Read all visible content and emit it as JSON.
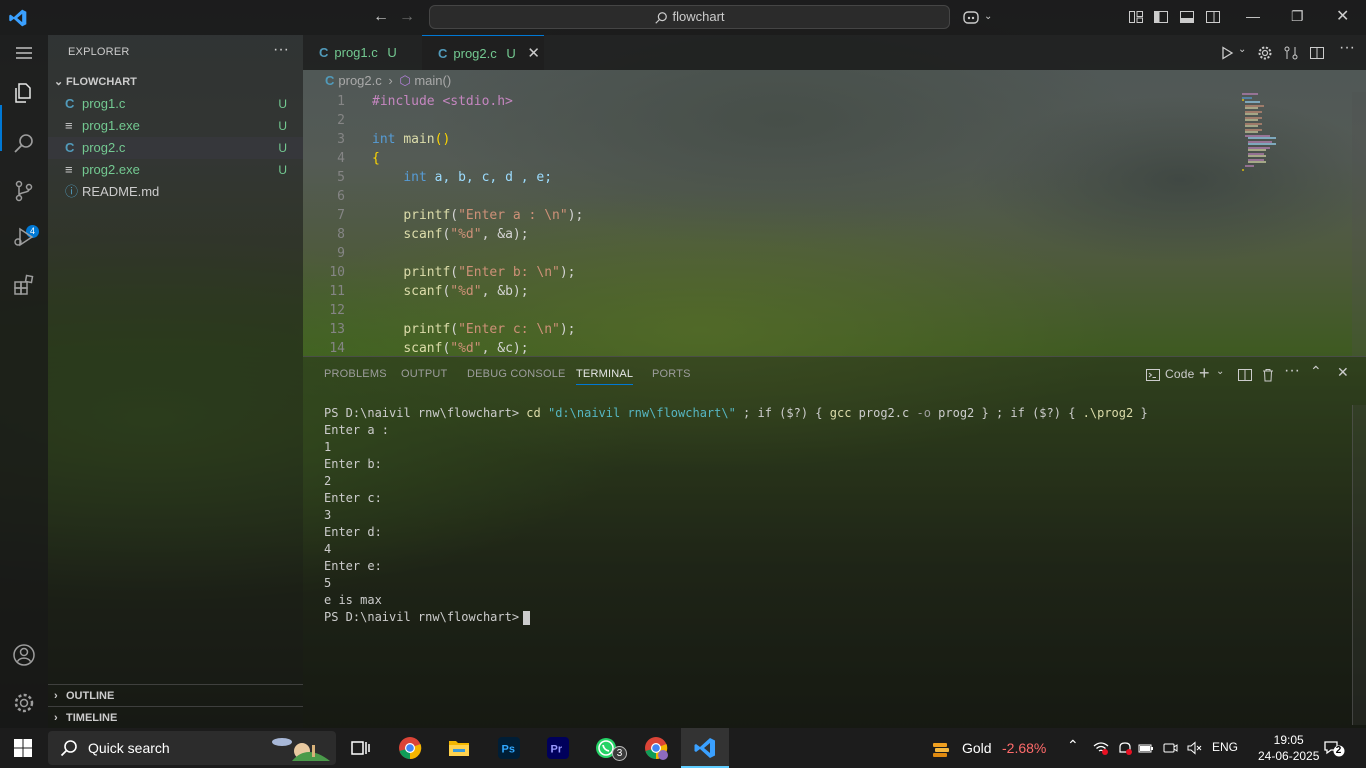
{
  "titlebar": {
    "search": "flowchart",
    "back": "←",
    "forward": "→"
  },
  "sidebar": {
    "title": "EXPLORER",
    "folder": "FLOWCHART",
    "files": [
      {
        "icon": "C",
        "name": "prog1.c",
        "status": "U"
      },
      {
        "icon": "≡",
        "name": "prog1.exe",
        "status": "U"
      },
      {
        "icon": "C",
        "name": "prog2.c",
        "status": "U"
      },
      {
        "icon": "≡",
        "name": "prog2.exe",
        "status": "U"
      },
      {
        "icon": "ⓘ",
        "name": "README.md",
        "status": ""
      }
    ],
    "outline": "OUTLINE",
    "timeline": "TIMELINE",
    "scm_badge": "4"
  },
  "tabs": [
    {
      "icon": "C",
      "label": "prog1.c",
      "status": "U"
    },
    {
      "icon": "C",
      "label": "prog2.c",
      "status": "U"
    }
  ],
  "breadcrumb": {
    "file": "prog2.c",
    "symbol": "main()"
  },
  "editor": {
    "line_numbers": [
      "1",
      "2",
      "3",
      "4",
      "5",
      "6",
      "7",
      "8",
      "9",
      "10",
      "11",
      "12",
      "13",
      "14"
    ],
    "lines": {
      "l1": "#include <stdio.h>",
      "l3a": "int",
      "l3b": "main",
      "l3c": "()",
      "l4": "{",
      "l5a": "int",
      "l5b": "a, b, c, d , e;",
      "l7a": "printf",
      "l7b": "(",
      "l7c": "\"Enter a : \\n\"",
      "l7d": ");",
      "l8a": "scanf",
      "l8b": "(",
      "l8c": "\"%d\"",
      "l8d": ", &a);",
      "l10a": "printf",
      "l10b": "(",
      "l10c": "\"Enter b: \\n\"",
      "l10d": ");",
      "l11a": "scanf",
      "l11b": "(",
      "l11c": "\"%d\"",
      "l11d": ", &b);",
      "l13a": "printf",
      "l13b": "(",
      "l13c": "\"Enter c: \\n\"",
      "l13d": ");",
      "l14a": "scanf",
      "l14b": "(",
      "l14c": "\"%d\"",
      "l14d": ", &c);"
    }
  },
  "panel": {
    "tabs": [
      "PROBLEMS",
      "OUTPUT",
      "DEBUG CONSOLE",
      "TERMINAL",
      "PORTS"
    ],
    "shell_label": "Code",
    "terminal": {
      "prompt1": "PS D:\\naivil rnw\\flowchart> ",
      "cmd_cd": "cd",
      "cmd_path": "\"d:\\naivil rnw\\flowchart\\\"",
      "cmd_sep1": " ; if ($?) { ",
      "cmd_gcc": "gcc",
      "cmd_gcc_args": " prog2.c ",
      "cmd_o": "-o",
      "cmd_rest1": " prog2 } ; if ($?) { ",
      "cmd_run": ".\\prog2",
      "cmd_end": " }",
      "output": [
        "Enter a :",
        "1",
        "Enter b:",
        "2",
        "Enter c:",
        "3",
        "Enter d:",
        "4",
        "Enter e:",
        "5",
        "e is max"
      ],
      "prompt2": "PS D:\\naivil rnw\\flowchart>"
    }
  },
  "taskbar": {
    "search": "Quick search",
    "whatsapp_badge": "3",
    "widget_label": "Gold",
    "widget_value": "-2.68%",
    "lang": "ENG",
    "time": "19:05",
    "date": "24-06-2025",
    "notifications": "2"
  },
  "colors": {
    "accent": "#0078d4",
    "untracked": "#73c991",
    "c_icon": "#519aba"
  }
}
